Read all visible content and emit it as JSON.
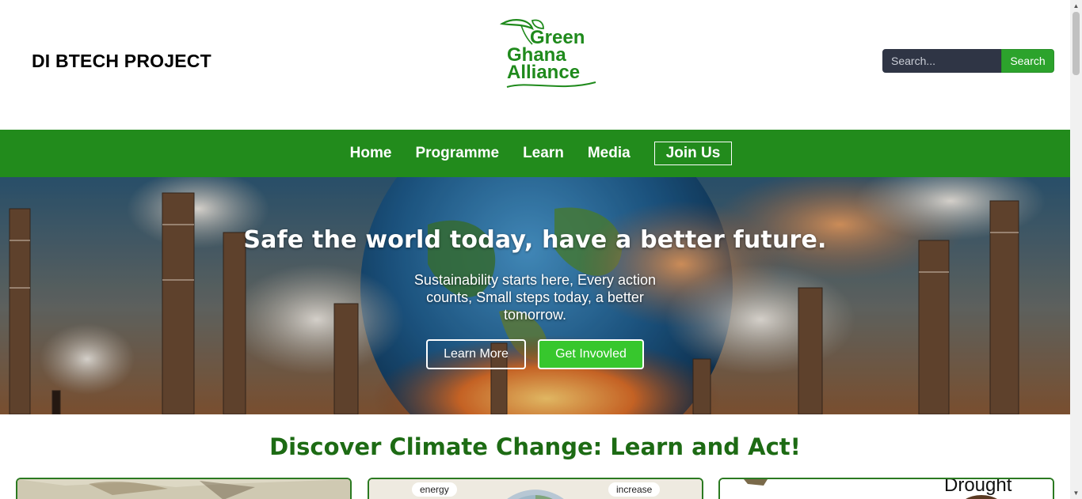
{
  "header": {
    "brand": "DI BTECH PROJECT",
    "logo": {
      "line1": "Green",
      "line2": "Ghana",
      "line3": "Alliance",
      "color": "#1f8a1c"
    },
    "search": {
      "placeholder": "Search...",
      "button_label": "Search"
    }
  },
  "nav": {
    "items": [
      {
        "label": "Home"
      },
      {
        "label": "Programme"
      },
      {
        "label": "Learn"
      },
      {
        "label": "Media"
      },
      {
        "label": "Join Us"
      }
    ],
    "color": "#228b1c"
  },
  "hero": {
    "title": "Safe the world today, have a better future.",
    "subtitle": "Sustainability starts here, Every action counts, Small steps today, a better tomorrow.",
    "learn_more": "Learn More",
    "get_involved": "Get Invovled",
    "accent": "#37c72d"
  },
  "discover": {
    "title": "Discover Climate Change: Learn and Act!",
    "cards": [
      {
        "labels": []
      },
      {
        "labels": [
          "energy",
          "increase"
        ]
      },
      {
        "labels": [
          "Drought"
        ]
      }
    ]
  }
}
